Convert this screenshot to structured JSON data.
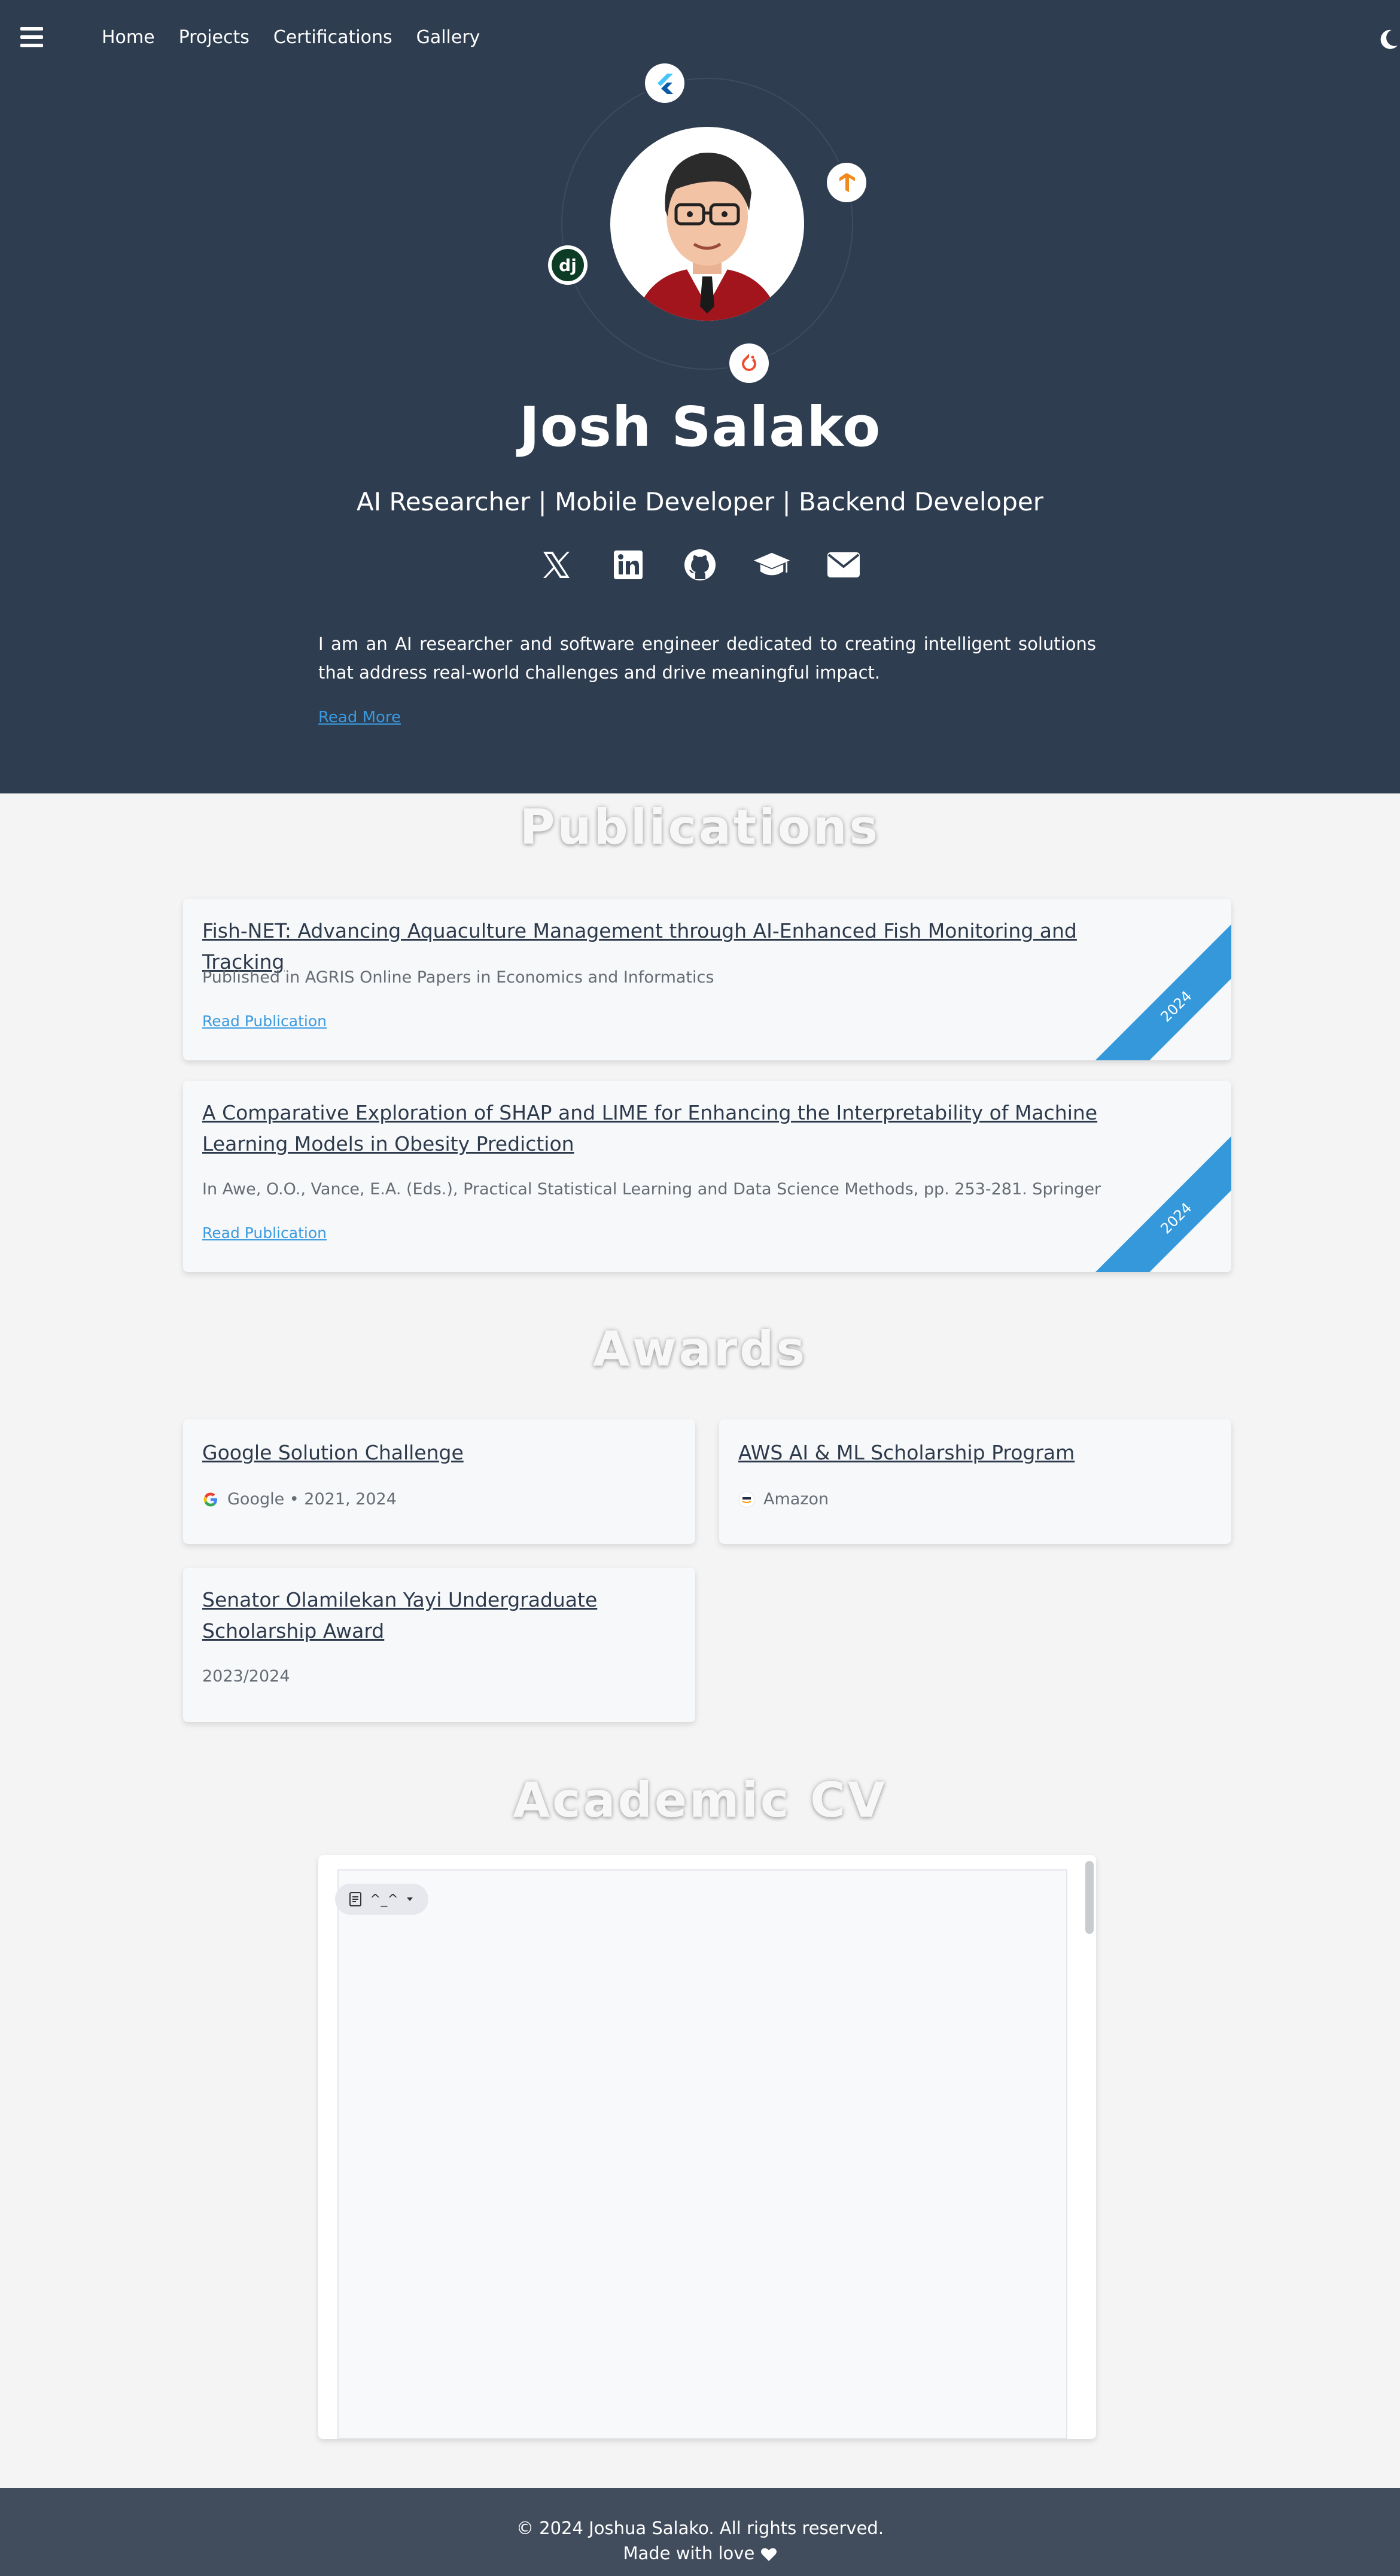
{
  "nav": {
    "links": [
      "Home",
      "Projects",
      "Certifications",
      "Gallery"
    ]
  },
  "hero": {
    "name": "Josh Salako",
    "roles": "AI Researcher | Mobile Developer | Backend Developer",
    "bio": "I am an AI researcher and software engineer dedicated to creating intelligent solutions that address real-world challenges and drive meaningful impact.",
    "read_more": "Read More",
    "tech_icons": [
      "flutter-icon",
      "tensorflow-icon",
      "django-icon",
      "pytorch-icon"
    ],
    "social_icons": [
      "x-icon",
      "linkedin-icon",
      "github-icon",
      "graduation-cap-icon",
      "envelope-icon"
    ]
  },
  "publications": {
    "title": "Publications",
    "items": [
      {
        "title": "Fish-NET: Advancing Aquaculture Management through AI-Enhanced Fish Monitoring and Tracking",
        "venue": "Published in AGRIS Online Papers in Economics and Informatics",
        "link": "Read Publication",
        "year": "2024"
      },
      {
        "title": "A Comparative Exploration of SHAP and LIME for Enhancing the Interpretability of Machine Learning Models in Obesity Prediction",
        "venue": "In Awe, O.O., Vance, E.A. (Eds.), Practical Statistical Learning and Data Science Methods, pp. 253-281. Springer",
        "link": "Read Publication",
        "year": "2024"
      }
    ]
  },
  "awards": {
    "title": "Awards",
    "items": [
      {
        "title": "Google Solution Challenge",
        "meta": "Google • 2021, 2024",
        "icon": "google-icon"
      },
      {
        "title": "AWS AI & ML Scholarship Program",
        "meta": "Amazon",
        "icon": "aws-icon"
      },
      {
        "title": "Senator Olamilekan Yayi Undergraduate Scholarship Award",
        "meta": "2023/2024"
      }
    ]
  },
  "cv": {
    "title": "Academic CV",
    "pill_text": "^_^"
  },
  "footer": {
    "copyright": "© 2024 Joshua Salako. All rights reserved.",
    "made_with": "Made with love"
  },
  "colors": {
    "hero_bg": "#2e3d50",
    "accent": "#3498db",
    "footer_bg": "#414c5c"
  }
}
